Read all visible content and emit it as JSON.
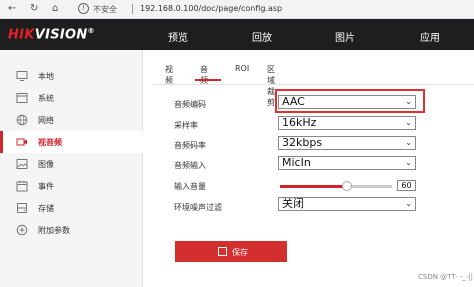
{
  "browser": {
    "security_text": "不安全",
    "url": "192.168.0.100/doc/page/config.asp"
  },
  "brand": {
    "logo_red": "HIK",
    "logo_white": "VISION",
    "logo_mark": "®"
  },
  "topnav": {
    "items": [
      {
        "label": "预览"
      },
      {
        "label": "回放"
      },
      {
        "label": "图片"
      },
      {
        "label": "应用"
      }
    ]
  },
  "sidebar": {
    "items": [
      {
        "label": "本地",
        "icon": "monitor-icon"
      },
      {
        "label": "系统",
        "icon": "system-icon"
      },
      {
        "label": "网络",
        "icon": "globe-icon"
      },
      {
        "label": "视音频",
        "icon": "video-audio-icon",
        "active": true
      },
      {
        "label": "图像",
        "icon": "image-icon"
      },
      {
        "label": "事件",
        "icon": "calendar-icon"
      },
      {
        "label": "存储",
        "icon": "storage-icon"
      },
      {
        "label": "附加参数",
        "icon": "extra-params-icon"
      }
    ]
  },
  "tabs": [
    {
      "label": "视频"
    },
    {
      "label": "音频",
      "active": true
    },
    {
      "label": "ROI"
    },
    {
      "label": "区域裁剪"
    }
  ],
  "form": {
    "audio_encoding": {
      "label": "音频编码",
      "value": "AAC"
    },
    "sample_rate": {
      "label": "采样率",
      "value": "16kHz"
    },
    "bitrate": {
      "label": "音频码率",
      "value": "32kbps"
    },
    "audio_input": {
      "label": "音频输入",
      "value": "MicIn"
    },
    "input_volume": {
      "label": "输入音量",
      "value": "60",
      "level_fraction": 0.6
    },
    "noise_filter": {
      "label": "环境噪声过滤",
      "value": "关闭"
    }
  },
  "save_button": {
    "label": "保存"
  },
  "watermark": "CSDN @TT- -_-||",
  "colors": {
    "accent": "#d2252c",
    "topbar_bg": "#1e1e1e",
    "highlight_box": "#e03030"
  }
}
